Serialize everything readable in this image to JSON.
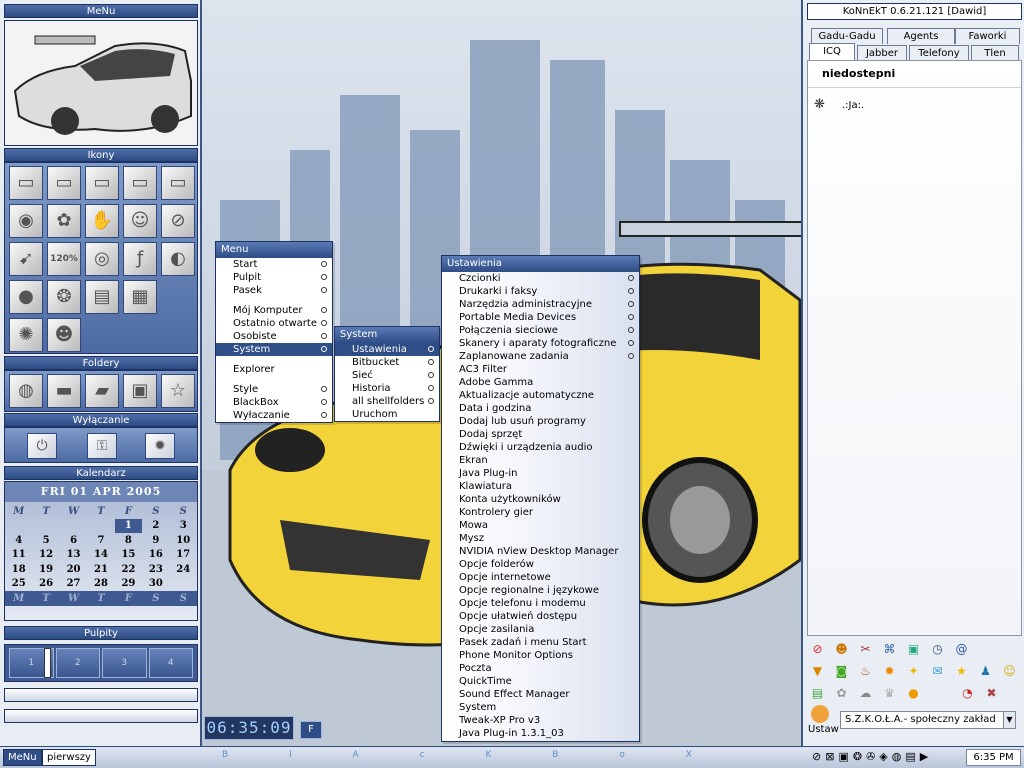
{
  "dock": {
    "menu_title": "MeNu",
    "ikony_title": "Ikony",
    "foldery_title": "Foldery",
    "wylaczanie_title": "Wyłączanie",
    "kalendarz_title": "Kalendarz",
    "pulpity_title": "Pulpity",
    "icons": [
      "drive-icon",
      "drive-icon",
      "drive-icon",
      "drive-icon",
      "drive-icon",
      "firefox-icon",
      "messenger-icon",
      "hand-icon",
      "bunny-icon",
      "no-entry-icon",
      "arrow-icon",
      "zoom-120-icon",
      "ring-icon",
      "flash-icon",
      "media-icon",
      "sphere-icon",
      "orb-icon",
      "film-icon",
      "checker-icon",
      "swirl-icon",
      "face-icon"
    ],
    "zoom_text": "120%",
    "folder_icons": [
      "disc-folder-icon",
      "drive-folder-icon",
      "folder-icon",
      "card-folder-icon",
      "star-folder-icon"
    ],
    "power_icons": [
      "power-icon",
      "key-icon",
      "sun-icon"
    ]
  },
  "calendar": {
    "header": "FRI 01 APR 2005",
    "day_names": [
      "M",
      "T",
      "W",
      "T",
      "F",
      "S",
      "S"
    ],
    "weeks": [
      [
        "",
        "",
        "",
        "",
        "1",
        "2",
        "3"
      ],
      [
        "4",
        "5",
        "6",
        "7",
        "8",
        "9",
        "10"
      ],
      [
        "11",
        "12",
        "13",
        "14",
        "15",
        "16",
        "17"
      ],
      [
        "18",
        "19",
        "20",
        "21",
        "22",
        "23",
        "24"
      ],
      [
        "25",
        "26",
        "27",
        "28",
        "29",
        "30",
        ""
      ]
    ],
    "today": "1"
  },
  "pulpity": [
    "1",
    "2",
    "3",
    "4"
  ],
  "clock": "06:35:09",
  "f_button": "F",
  "menu": {
    "title": "Menu",
    "items": [
      {
        "label": "Start",
        "sub": true
      },
      {
        "label": "Pulpit",
        "sub": true
      },
      {
        "label": "Pasek",
        "sub": true
      },
      {
        "sep": true
      },
      {
        "label": "Mój Komputer",
        "sub": true
      },
      {
        "label": "Ostatnio otwarte",
        "sub": true
      },
      {
        "label": "Osobiste",
        "sub": true
      },
      {
        "label": "System",
        "sub": true,
        "selected": true
      },
      {
        "sep": true
      },
      {
        "label": "Explorer",
        "sub": false
      },
      {
        "sep": true
      },
      {
        "label": "Style",
        "sub": true
      },
      {
        "label": "BlackBox",
        "sub": true
      },
      {
        "label": "Wyłaczanie",
        "sub": true
      }
    ]
  },
  "system_menu": {
    "title": "System",
    "items": [
      {
        "label": "Ustawienia",
        "sub": true,
        "selected": true
      },
      {
        "label": "Bitbucket",
        "sub": true
      },
      {
        "label": "Sieć",
        "sub": true
      },
      {
        "label": "Historia",
        "sub": true
      },
      {
        "label": "all shellfolders",
        "sub": true
      },
      {
        "label": "Uruchom",
        "sub": false
      }
    ]
  },
  "settings_menu": {
    "title": "Ustawienia",
    "items": [
      {
        "label": "Czcionki",
        "sub": true
      },
      {
        "label": "Drukarki i faksy",
        "sub": true
      },
      {
        "label": "Narzędzia administracyjne",
        "sub": true
      },
      {
        "label": "Portable Media Devices",
        "sub": true
      },
      {
        "label": "Połączenia sieciowe",
        "sub": true
      },
      {
        "label": "Skanery i aparaty fotograficzne",
        "sub": true
      },
      {
        "label": "Zaplanowane zadania",
        "sub": true
      },
      {
        "label": "AC3 Filter"
      },
      {
        "label": "Adobe Gamma"
      },
      {
        "label": "Aktualizacje automatyczne"
      },
      {
        "label": "Data i godzina"
      },
      {
        "label": "Dodaj lub usuń programy"
      },
      {
        "label": "Dodaj sprzęt"
      },
      {
        "label": "Dźwięki i urządzenia audio"
      },
      {
        "label": "Ekran"
      },
      {
        "label": "Java Plug-in"
      },
      {
        "label": "Klawiatura"
      },
      {
        "label": "Konta użytkowników"
      },
      {
        "label": "Kontrolery gier"
      },
      {
        "label": "Mowa"
      },
      {
        "label": "Mysz"
      },
      {
        "label": "NVIDIA nView Desktop Manager"
      },
      {
        "label": "Opcje folderów"
      },
      {
        "label": "Opcje internetowe"
      },
      {
        "label": "Opcje regionalne i językowe"
      },
      {
        "label": "Opcje telefonu i modemu"
      },
      {
        "label": "Opcje ułatwień dostępu"
      },
      {
        "label": "Opcje zasilania"
      },
      {
        "label": "Pasek zadań i menu Start"
      },
      {
        "label": "Phone Monitor Options"
      },
      {
        "label": "Poczta"
      },
      {
        "label": "QuickTime"
      },
      {
        "label": "Sound Effect Manager"
      },
      {
        "label": "System"
      },
      {
        "label": "Tweak-XP Pro v3"
      },
      {
        "label": "Java Plug-in 1.3.1_03"
      }
    ]
  },
  "konnekt": {
    "title": "KoNnEkT 0.6.21.121 [Dawid]",
    "tabs_row1": [
      "Gadu-Gadu",
      "Agents",
      "Faworki"
    ],
    "tabs_row2": [
      "ICQ",
      "Jabber",
      "Telefony",
      "Tlen"
    ],
    "group": "niedostepni",
    "contact": ".:Ja:.",
    "status_label": "Ustaw",
    "status_text": "S.Z.K.O.Ł.A.- społeczny zakład",
    "toolbar_icons": [
      "no-entry-icon",
      "face-icon",
      "tools-icon",
      "network-icon",
      "screen-icon",
      "clock-icon",
      "at-icon",
      "funnel-icon",
      "bucket-icon",
      "cup-icon",
      "sun-icon",
      "bulb-icon",
      "chat-icon",
      "star-icon",
      "people-icon",
      "smile-icon",
      "note-icon",
      "flower-icon",
      "cloud-icon",
      "award-icon",
      "ball-icon",
      "alarm-icon",
      "wrench-icon"
    ]
  },
  "taskbar": {
    "menu_button": "MeNu",
    "workspace_button": "pierwszy",
    "blackbox_letters": [
      "B",
      "l",
      "A",
      "c",
      "K",
      "B",
      "o",
      "X"
    ],
    "time": "6:35 PM"
  }
}
